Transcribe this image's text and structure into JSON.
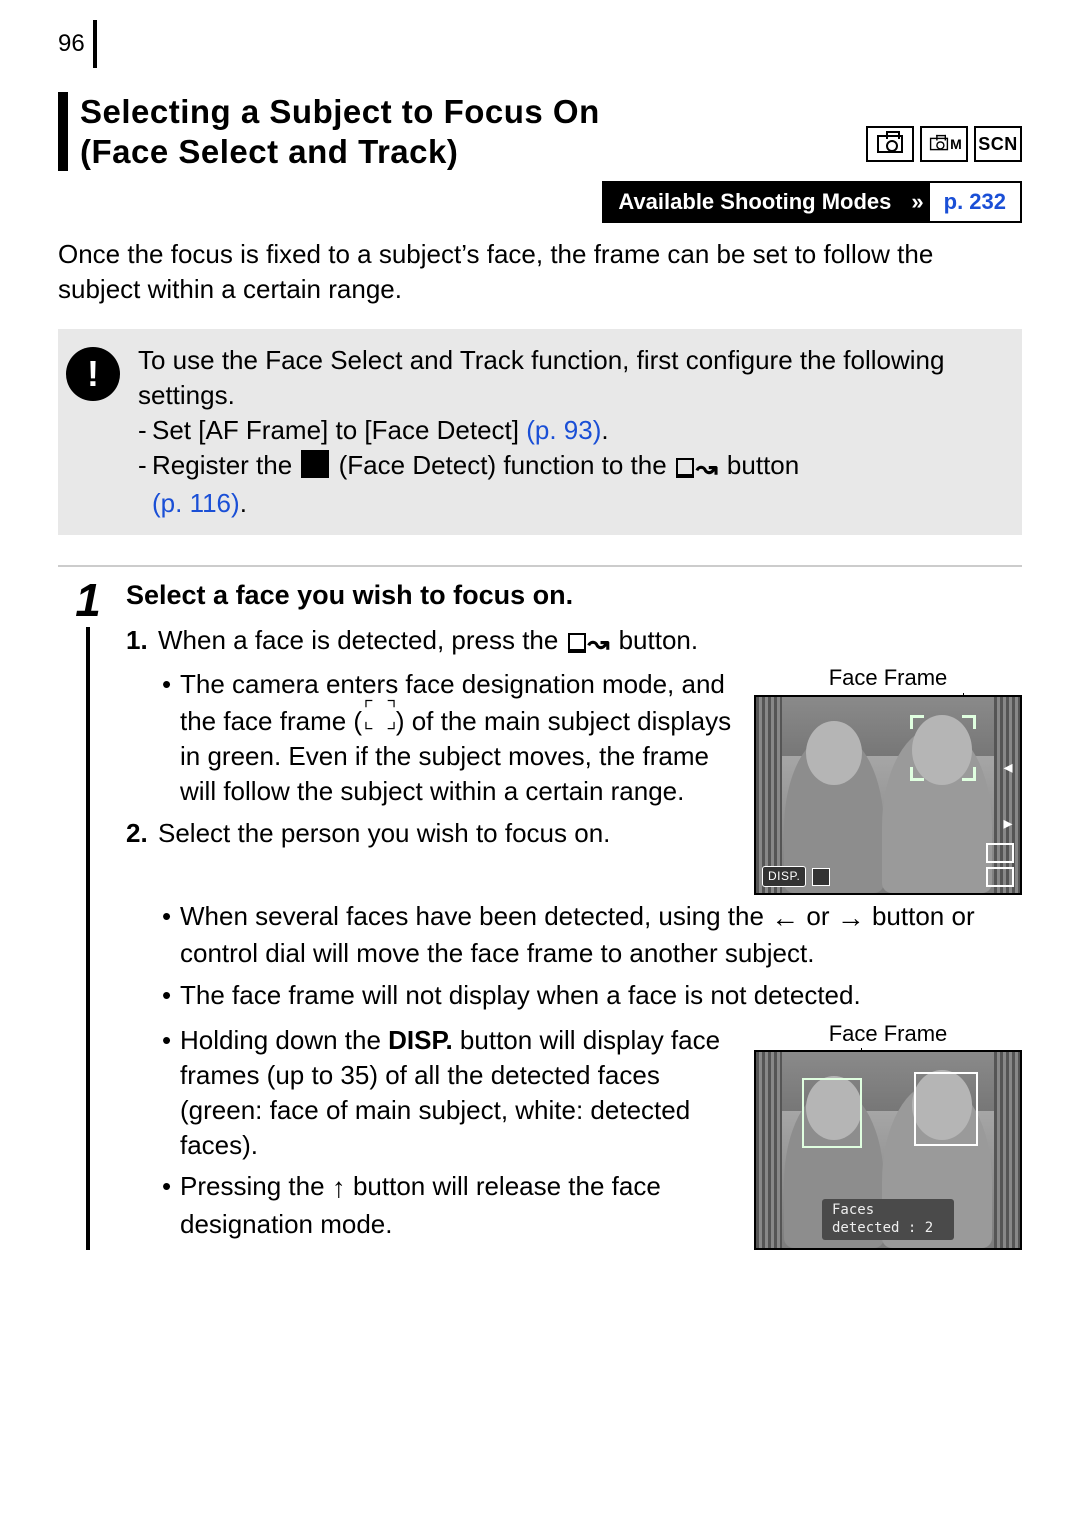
{
  "page_number": "96",
  "heading": {
    "title_line1": "Selecting a Subject to Focus On",
    "title_line2": "(Face Select and Track)"
  },
  "mode_icons": {
    "camera": "camera-icon",
    "cam_manual": "M",
    "scn": "SCN"
  },
  "avail": {
    "label": "Available Shooting Modes",
    "chev": "»",
    "page_ref": "p. 232"
  },
  "intro": "Once the focus is fixed to a subject’s face, the frame can be set to follow the subject within a certain range.",
  "note": {
    "icon": "!",
    "lead": "To use the Face Select and Track function, first configure the following settings.",
    "dash1_pre": "Set [AF Frame] to [Face Detect] ",
    "dash1_link": "(p. 93)",
    "dash1_post": ".",
    "dash2_pre": "Register the ",
    "dash2_mid": " (Face Detect) function to the ",
    "dash2_post": " button ",
    "dash2_link": "(p. 116)",
    "dash2_end": "."
  },
  "step": {
    "num": "1",
    "title": "Select a face you wish to focus on.",
    "sub1_num": "1.",
    "sub1_pre": "When a face is detected, press the ",
    "sub1_post": " button.",
    "bullet1_a": "The camera enters face designation mode, and the face frame (",
    "bullet1_b": ") of the main subject displays in green. Even if the subject moves, the frame will follow the subject within a certain range.",
    "sub2_num": "2.",
    "sub2_text": "Select the person you wish to focus on.",
    "bullet2_a": "When several faces have been detected, using the ",
    "bullet2_or": " or ",
    "bullet2_b": " button or control dial will move the face frame to another subject.",
    "bullet3": "The face frame will not display when a face is not detected.",
    "bullet4_a": "Holding down the ",
    "bullet4_disp": "DISP.",
    "bullet4_b": " button will display face frames (up to 35) of all the detected faces (green: face of main subject, white: detected faces).",
    "bullet5_a": "Pressing the ",
    "bullet5_b": " button will release the face designation mode."
  },
  "figures": {
    "label1": "Face Frame",
    "label2": "Face Frame",
    "disp_badge": "DISP.",
    "status_text": "Faces detected : 2"
  }
}
